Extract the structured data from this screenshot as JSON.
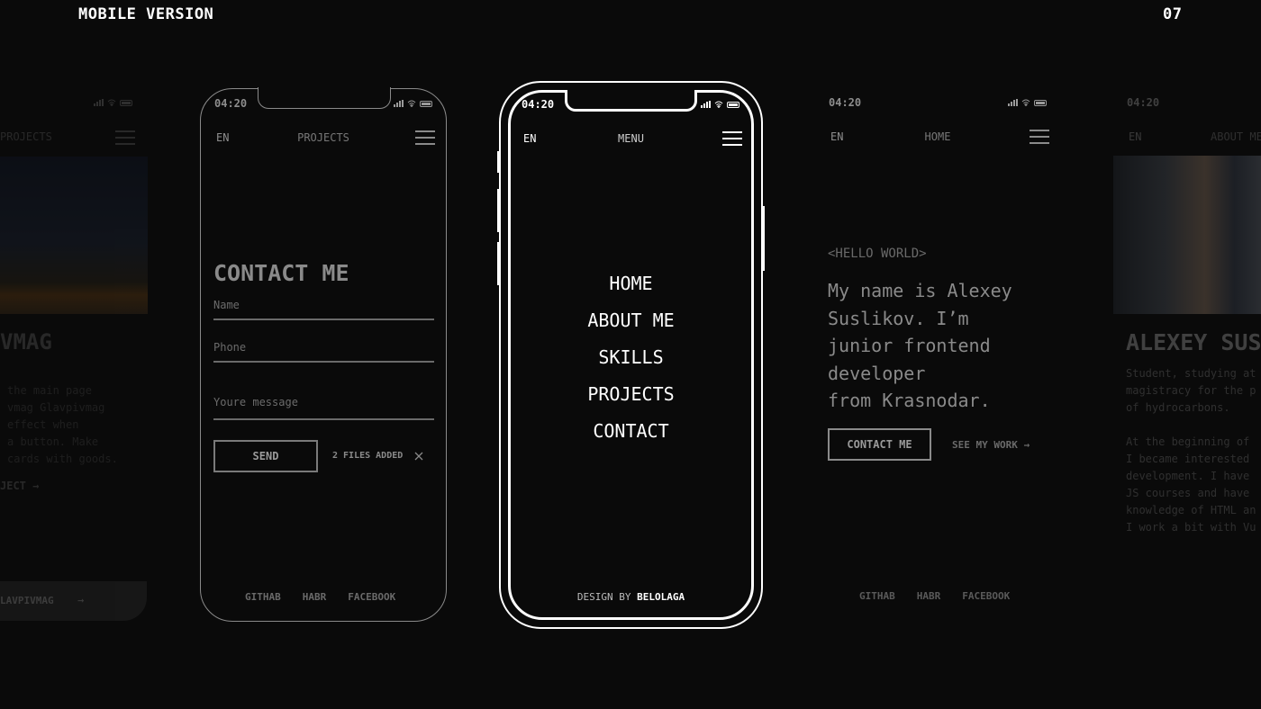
{
  "header": {
    "title": "MOBILE VERSION",
    "page_number": "07"
  },
  "status_bar": {
    "time": "04:20"
  },
  "far_left": {
    "nav_title": "PROJECTS",
    "project_title": "VMAG",
    "description_lines": [
      "the main page",
      "vmag Glavpivmag",
      "effect when",
      "a button. Make",
      "cards with goods."
    ],
    "project_link": "JECT →",
    "bottom_bar_text": "LAVPIVMAG",
    "bottom_bar_arrow": "→"
  },
  "contact_phone": {
    "lang": "EN",
    "nav_title": "PROJECTS",
    "heading": "CONTACT ME",
    "name_placeholder": "Name",
    "phone_placeholder": "Phone",
    "message_placeholder": "Youre message",
    "send_label": "SEND",
    "files_text": "2 FILES ADDED",
    "footer": [
      "GITHAB",
      "HABR",
      "FACEBOOK"
    ]
  },
  "menu_phone": {
    "lang": "EN",
    "nav_title": "MENU",
    "items": [
      "HOME",
      "ABOUT ME",
      "SKILLS",
      "PROJECTS",
      "CONTACT"
    ],
    "credit_prefix": "DESIGN BY",
    "credit_name": "BELOLAGA"
  },
  "home_phone": {
    "lang": "EN",
    "nav_title": "HOME",
    "tag": "<HELLO WORLD>",
    "intro_lines": [
      "My name is Alexey",
      "Suslikov. I’m",
      "junior frontend",
      "developer",
      "from Krasnodar."
    ],
    "contact_label": "CONTACT ME",
    "see_work_label": "SEE MY WORK →",
    "footer": [
      "GITHAB",
      "HABR",
      "FACEBOOK"
    ]
  },
  "about_phone": {
    "lang": "EN",
    "nav_title": "ABOUT ME",
    "name_heading": "ALEXEY SUS",
    "bio_lines_1": [
      "Student, studying at",
      "magistracy for the p",
      "of hydrocarbons."
    ],
    "bio_lines_2": [
      "At the beginning of",
      "I became interested",
      "development. I have",
      "JS courses and have",
      "knowledge of HTML an",
      "I work a bit with Vu"
    ]
  }
}
